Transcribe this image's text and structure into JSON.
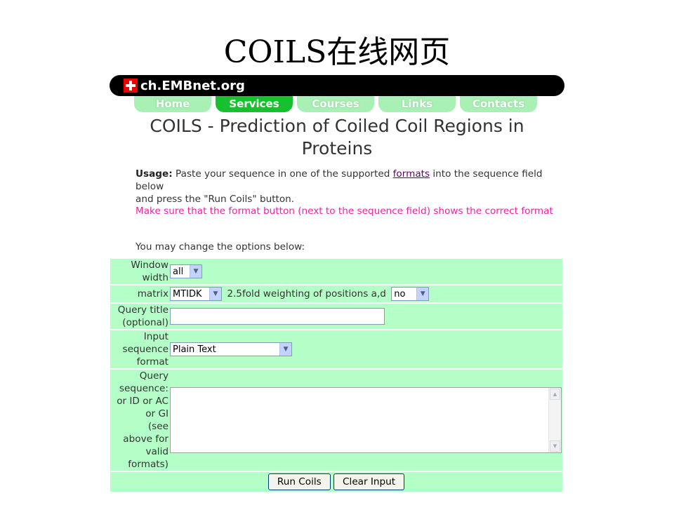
{
  "slide": {
    "title": "COILS在线网页"
  },
  "site": {
    "logo_text": "ch.EMBnet.org"
  },
  "nav": {
    "tabs": [
      {
        "label": "Home",
        "active": false
      },
      {
        "label": "Services",
        "active": true
      },
      {
        "label": "Courses",
        "active": false
      },
      {
        "label": "Links",
        "active": false
      },
      {
        "label": "Contacts",
        "active": false
      }
    ]
  },
  "page": {
    "heading_line1": "COILS - Prediction of Coiled Coil Regions in",
    "heading_line2": "Proteins"
  },
  "usage": {
    "label": "Usage:",
    "text1": " Paste your sequence in one of the supported ",
    "link": "formats",
    "text2": " into the sequence field below",
    "text3": "and press the \"Run Coils\" button.",
    "warning": "Make sure that the format button (next to the sequence field) shows the correct format"
  },
  "options_note": "You may change the options below:",
  "form": {
    "window_width": {
      "label1": "Window",
      "label2": "width",
      "value": "all"
    },
    "matrix": {
      "label": "matrix",
      "value": "MTIDK",
      "weighting_label": "2.5fold weighting of positions a,d",
      "weighting_value": "no"
    },
    "query_title": {
      "label1": "Query title",
      "label2": "(optional)",
      "value": ""
    },
    "input_format": {
      "label1": "Input",
      "label2": "sequence",
      "label3": "format",
      "value": "Plain Text"
    },
    "query_sequence": {
      "label_lines": [
        "Query",
        "sequence:",
        "or ID or AC",
        "or GI",
        "(see",
        "above for",
        "valid",
        "formats)"
      ],
      "value": ""
    },
    "buttons": {
      "run": "Run Coils",
      "clear": "Clear Input"
    }
  },
  "colors": {
    "form_bg": "#b4ffc8",
    "nav_active": "#18c030",
    "nav_inactive": "#a8f0b4",
    "warning": "#ee22aa"
  }
}
